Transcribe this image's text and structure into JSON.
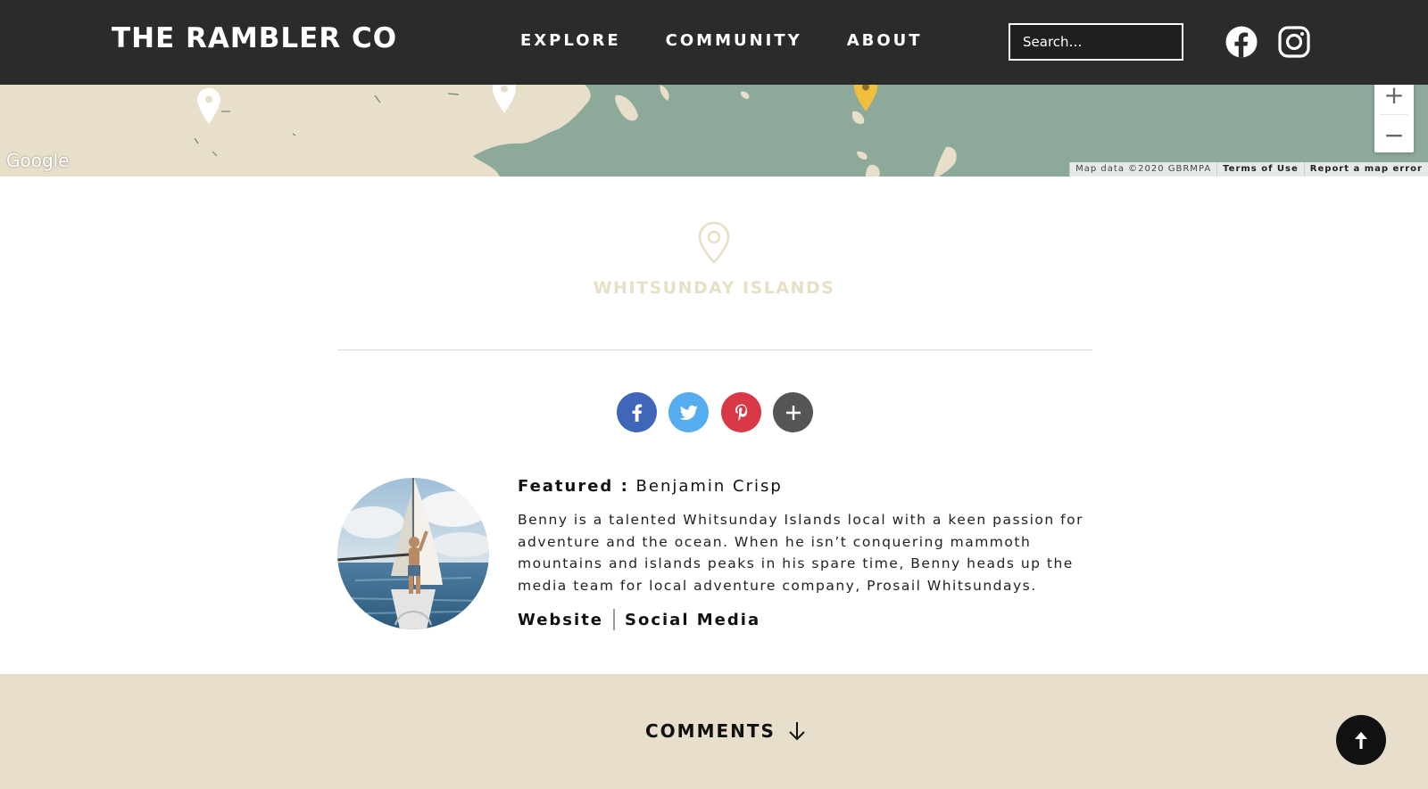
{
  "header": {
    "logo": "THE RAMBLER CO",
    "nav": [
      "EXPLORE",
      "COMMUNITY",
      "ABOUT"
    ],
    "search_placeholder": "Search…",
    "social_icons": [
      "facebook-icon",
      "instagram-icon"
    ]
  },
  "map": {
    "google_label": "Google",
    "attribution": [
      "Map data ©2020 GBRMPA",
      "Terms of Use",
      "Report a map error"
    ],
    "zoom_in": "+",
    "zoom_out": "−",
    "land_color": "#e7dfca",
    "water_color": "#8da99a",
    "active_pin_color": "#f0bf3c"
  },
  "location": {
    "name": "WHITSUNDAY ISLANDS",
    "color": "#e8dfc7"
  },
  "share": {
    "buttons": [
      "facebook-icon",
      "twitter-icon",
      "pinterest-icon",
      "plus-icon"
    ],
    "colors": [
      "#3f66b8",
      "#55acee",
      "#d93947",
      "#555555"
    ]
  },
  "featured": {
    "label": "Featured :",
    "name": "Benjamin Crisp",
    "bio": "Benny is a talented Whitsunday Islands local with a keen passion for adventure and the ocean. When he isn’t conquering mammoth mountains and islands peaks in his spare time, Benny heads up the media team for local adventure company, Prosail Whitsundays.",
    "links": [
      "Website",
      "Social Media"
    ]
  },
  "comments": {
    "title": "COMMENTS",
    "background": "#e7dfcb"
  }
}
